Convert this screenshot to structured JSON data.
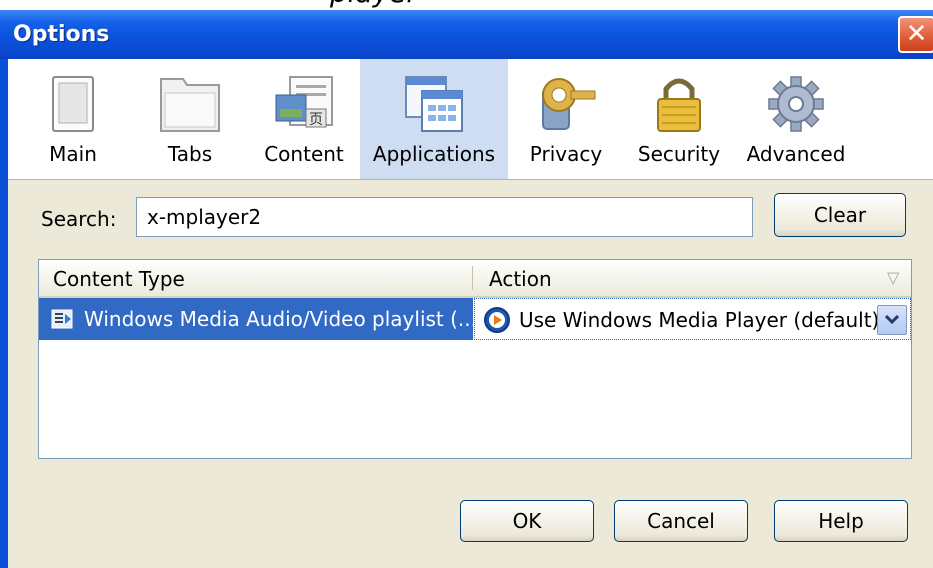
{
  "window": {
    "title": "Options",
    "close_glyph": "✕"
  },
  "background_text": "player",
  "panes": [
    {
      "label": "Main",
      "icon": "main-pane-icon"
    },
    {
      "label": "Tabs",
      "icon": "tabs-pane-icon"
    },
    {
      "label": "Content",
      "icon": "content-pane-icon"
    },
    {
      "label": "Applications",
      "icon": "applications-pane-icon",
      "selected": true
    },
    {
      "label": "Privacy",
      "icon": "privacy-pane-icon"
    },
    {
      "label": "Security",
      "icon": "security-pane-icon"
    },
    {
      "label": "Advanced",
      "icon": "advanced-pane-icon"
    }
  ],
  "search": {
    "label": "Search:",
    "value": "x-mplayer2",
    "clear_label": "Clear"
  },
  "list": {
    "headers": [
      "Content Type",
      "Action"
    ],
    "rows": [
      {
        "content_type": "Windows Media Audio/Video playlist (...",
        "action": "Use Windows Media Player (default)",
        "selected": true
      }
    ]
  },
  "buttons": {
    "ok": "OK",
    "cancel": "Cancel",
    "help": "Help"
  },
  "colors": {
    "titlebar": "#0a4fd8",
    "selection": "#316ac5",
    "dialog_bg": "#ece9d8",
    "close_red": "#e05a36"
  }
}
